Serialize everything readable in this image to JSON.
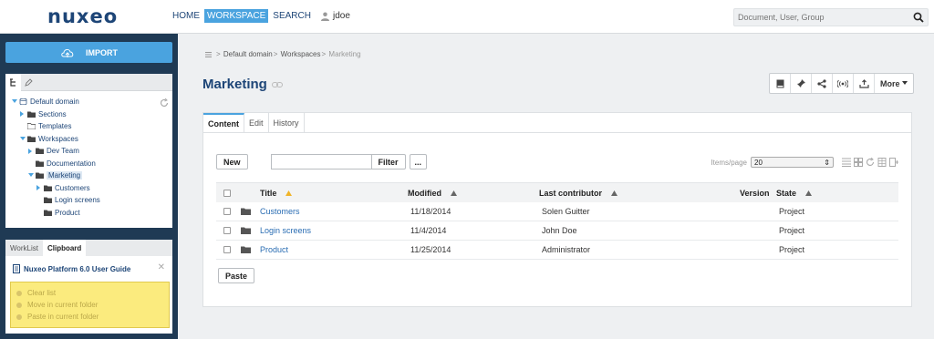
{
  "header": {
    "logo": "nuxeo",
    "nav": [
      {
        "label": "HOME",
        "active": false
      },
      {
        "label": "WORKSPACE",
        "active": true
      },
      {
        "label": "SEARCH",
        "active": false
      }
    ],
    "user": "jdoe",
    "search_placeholder": "Document, User, Group"
  },
  "sidebar": {
    "import_label": "IMPORT",
    "tree": [
      {
        "label": "Default domain",
        "depth": 0,
        "expanded": true,
        "icon": "domain-icon"
      },
      {
        "label": "Sections",
        "depth": 1,
        "expanded": false,
        "icon": "sections-icon"
      },
      {
        "label": "Templates",
        "depth": 1,
        "expanded": null,
        "icon": "templates-icon"
      },
      {
        "label": "Workspaces",
        "depth": 1,
        "expanded": true,
        "icon": "folder-icon"
      },
      {
        "label": "Dev Team",
        "depth": 2,
        "expanded": false,
        "icon": "folder-icon"
      },
      {
        "label": "Documentation",
        "depth": 2,
        "expanded": null,
        "icon": "folder-icon"
      },
      {
        "label": "Marketing",
        "depth": 2,
        "expanded": true,
        "icon": "folder-icon",
        "selected": true
      },
      {
        "label": "Customers",
        "depth": 3,
        "expanded": false,
        "icon": "folder-icon"
      },
      {
        "label": "Login screens",
        "depth": 3,
        "expanded": null,
        "icon": "folder-icon"
      },
      {
        "label": "Product",
        "depth": 3,
        "expanded": null,
        "icon": "folder-icon"
      }
    ],
    "clipboard": {
      "tabs": [
        {
          "label": "WorkList",
          "active": false
        },
        {
          "label": "Clipboard",
          "active": true
        }
      ],
      "document": "Nuxeo Platform 6.0 User Guide",
      "actions": [
        "Clear list",
        "Move in current folder",
        "Paste in current folder"
      ]
    }
  },
  "main": {
    "breadcrumb": {
      "items": [
        "Default domain",
        "Workspaces"
      ],
      "current": "Marketing",
      "sep": ">"
    },
    "title": "Marketing",
    "more_label": "More",
    "tabs": [
      {
        "label": "Content",
        "active": true
      },
      {
        "label": "Edit",
        "active": false
      },
      {
        "label": "History",
        "active": false
      }
    ],
    "new_label": "New",
    "filter_label": "Filter",
    "dots_label": "...",
    "items_per_page_label": "Items/page",
    "items_per_page_value": "20",
    "columns": {
      "title": "Title",
      "modified": "Modified",
      "contributor": "Last contributor",
      "version": "Version",
      "state": "State"
    },
    "rows": [
      {
        "title": "Customers",
        "modified": "11/18/2014",
        "contributor": "Solen Guitter",
        "version": "",
        "state": "Project"
      },
      {
        "title": "Login screens",
        "modified": "11/4/2014",
        "contributor": "John Doe",
        "version": "",
        "state": "Project"
      },
      {
        "title": "Product",
        "modified": "11/25/2014",
        "contributor": "Administrator",
        "version": "",
        "state": "Project"
      }
    ],
    "paste_label": "Paste"
  },
  "colors": {
    "accent": "#4aa3df",
    "brand": "#1d4577",
    "sidebar_bg": "#1f3a54",
    "clipboard_highlight": "#fbeb7e"
  }
}
